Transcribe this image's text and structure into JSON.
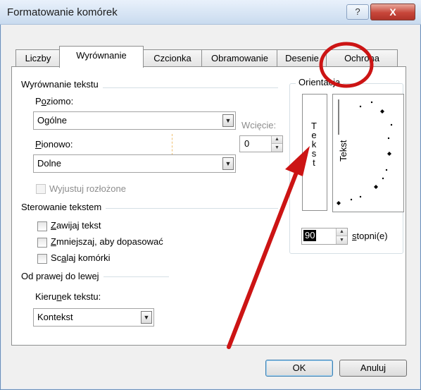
{
  "window": {
    "title": "Formatowanie komórek",
    "help_glyph": "?",
    "close_glyph": "X"
  },
  "tabs": [
    {
      "label": "Liczby"
    },
    {
      "label": "Wyrównanie",
      "active": true
    },
    {
      "label": "Czcionka"
    },
    {
      "label": "Obramowanie"
    },
    {
      "label": "Desenie"
    },
    {
      "label": "Ochrona"
    }
  ],
  "alignment": {
    "section_title": "Wyrównanie tekstu",
    "horizontal_label_prefix": "P",
    "horizontal_label_u": "o",
    "horizontal_label_rest": "ziomo:",
    "horizontal_value": "Ogólne",
    "vertical_label_u": "P",
    "vertical_label_rest": "ionowo:",
    "vertical_value": "Dolne",
    "indent_label": "Wcięcie:",
    "indent_value": "0",
    "justify_distributed": "Wyjustuj rozłożone"
  },
  "text_control": {
    "section_title": "Sterowanie tekstem",
    "wrap_u": "Z",
    "wrap_rest": "awijaj tekst",
    "shrink_u": "Z",
    "shrink_rest": "mniejszaj, aby dopasować",
    "merge_prefix": "Sc",
    "merge_u": "a",
    "merge_rest": "laj komórki"
  },
  "rtl": {
    "section_title": "Od prawej do lewej",
    "direction_label_prefix": "Kieru",
    "direction_label_u": "n",
    "direction_label_rest": "ek tekstu:",
    "direction_value": "Kontekst"
  },
  "orientation": {
    "title": "Orientacja",
    "vertical_text_letters": [
      "T",
      "e",
      "k",
      "s",
      "t"
    ],
    "dial_text": "Tekst",
    "degrees_value": "90",
    "degrees_label_u": "s",
    "degrees_label_rest": "topni(e)"
  },
  "buttons": {
    "ok": "OK",
    "cancel": "Anuluj"
  },
  "colors": {
    "annotation_red": "#cc1414",
    "selection_black": "#000000"
  }
}
